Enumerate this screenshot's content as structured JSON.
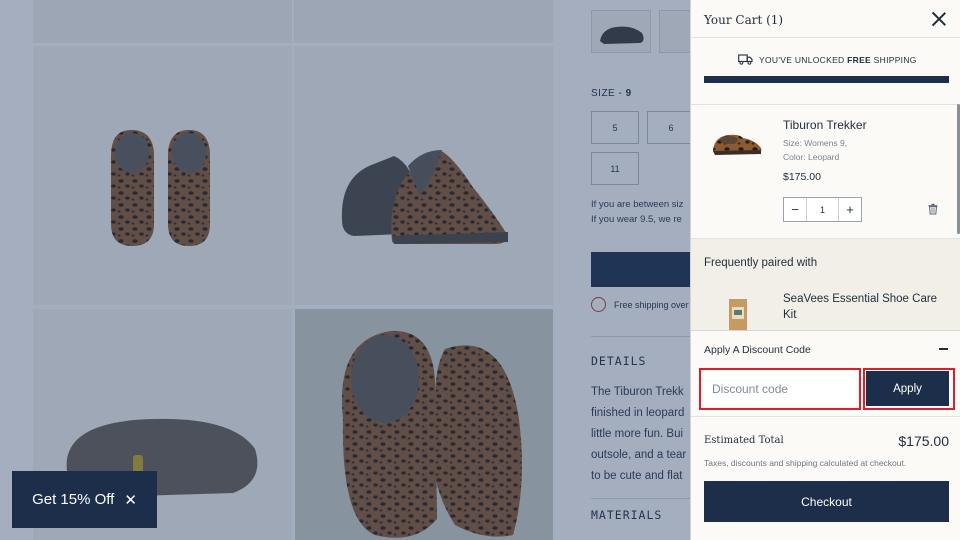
{
  "product_page": {
    "size_label": "SIZE - ",
    "size_value": "9",
    "sizes": [
      "5",
      "6",
      "11"
    ],
    "fit_note_1": "If you are between siz",
    "fit_note_2": "If you wear 9.5, we re",
    "free_shipping_note": "Free shipping over",
    "details_heading": "DETAILS",
    "details_lines": [
      "The Tiburon Trekk",
      "finished in leopard",
      "little more fun. Bui",
      "outsole, and a tear",
      "to be cute and flat"
    ],
    "materials_heading": "MATERIALS"
  },
  "promo": {
    "label": "Get 15% Off",
    "close_icon": "✕"
  },
  "cart": {
    "title": "Your Cart (1)",
    "shipping_prefix": "YOU'VE UNLOCKED ",
    "shipping_bold": "FREE",
    "shipping_suffix": " SHIPPING",
    "shipping_progress": 1.0,
    "item": {
      "name": "Tiburon Trekker",
      "size": "Size: Womens 9,",
      "color": "Color: Leopard",
      "price": "$175.00",
      "quantity": "1",
      "minus": "−",
      "plus": "+"
    },
    "paired_title": "Frequently paired with",
    "paired_name": "SeaVees Essential Shoe Care Kit",
    "discount_title": "Apply A Discount Code",
    "discount_placeholder": "Discount code",
    "apply_label": "Apply",
    "estimated_total_label": "Estimated Total",
    "estimated_total_value": "$175.00",
    "tax_note": "Taxes, discounts and shipping calculated at checkout.",
    "checkout_label": "Checkout"
  },
  "colors": {
    "navy": "#1c2e4a",
    "drawer_bg": "#fbfaf6",
    "highlight_red": "#d6202d",
    "overlay": "rgba(38,62,100,0.42)"
  },
  "icons": {
    "close": "close-icon",
    "truck": "truck-icon",
    "trash": "trash-icon",
    "minus": "minus-icon"
  }
}
